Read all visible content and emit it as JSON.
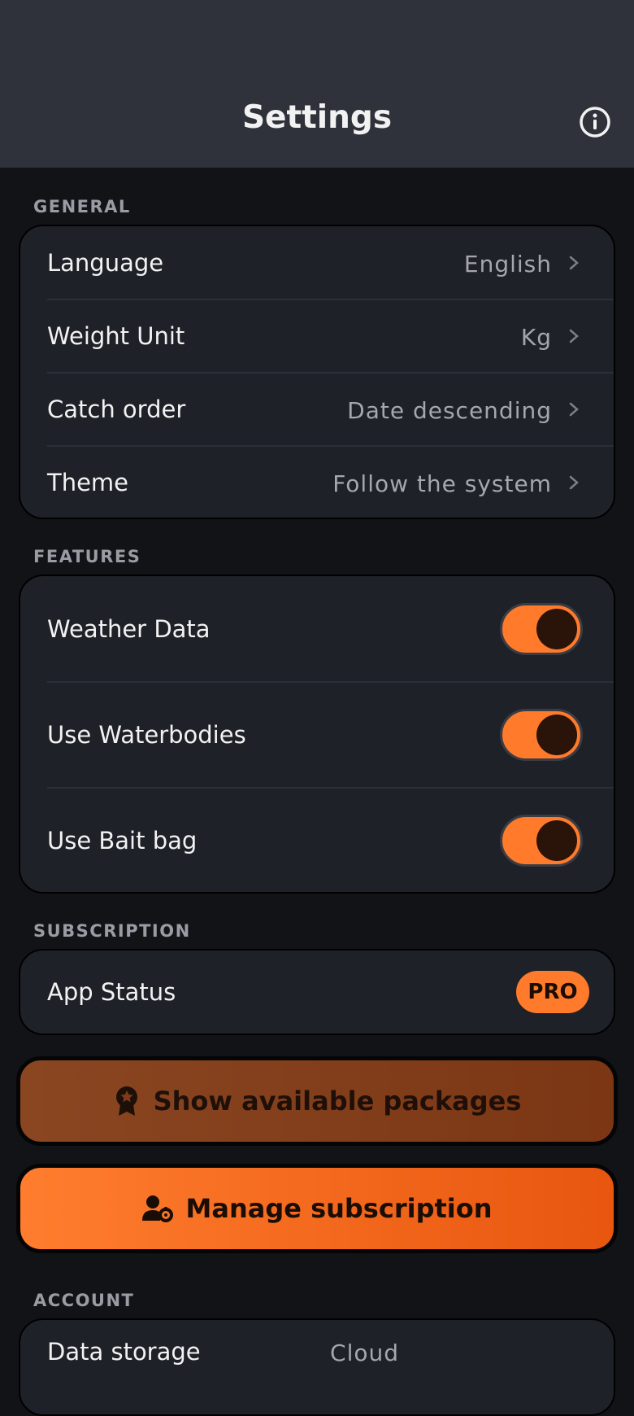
{
  "header": {
    "title": "Settings",
    "info_icon": "info-circle-icon"
  },
  "general": {
    "label": "GENERAL",
    "rows": [
      {
        "label": "Language",
        "value": "English"
      },
      {
        "label": "Weight Unit",
        "value": "Kg"
      },
      {
        "label": "Catch order",
        "value": "Date descending"
      },
      {
        "label": "Theme",
        "value": "Follow the system"
      }
    ]
  },
  "features": {
    "label": "FEATURES",
    "rows": [
      {
        "label": "Weather Data",
        "enabled": true
      },
      {
        "label": "Use Waterbodies",
        "enabled": true
      },
      {
        "label": "Use Bait bag",
        "enabled": true
      }
    ]
  },
  "subscription": {
    "label": "SUBSCRIPTION",
    "app_status_label": "App Status",
    "badge": "PRO",
    "packages_button": "Show available packages",
    "packages_icon": "award-badge-icon",
    "manage_button": "Manage subscription",
    "manage_icon": "user-gear-icon"
  },
  "account": {
    "label": "ACCOUNT",
    "rows": [
      {
        "label": "Data storage",
        "value": "Cloud"
      }
    ]
  },
  "colors": {
    "accent": "#ff7a2a",
    "background": "#121317",
    "card": "#1f2128",
    "header": "#2f323a"
  }
}
